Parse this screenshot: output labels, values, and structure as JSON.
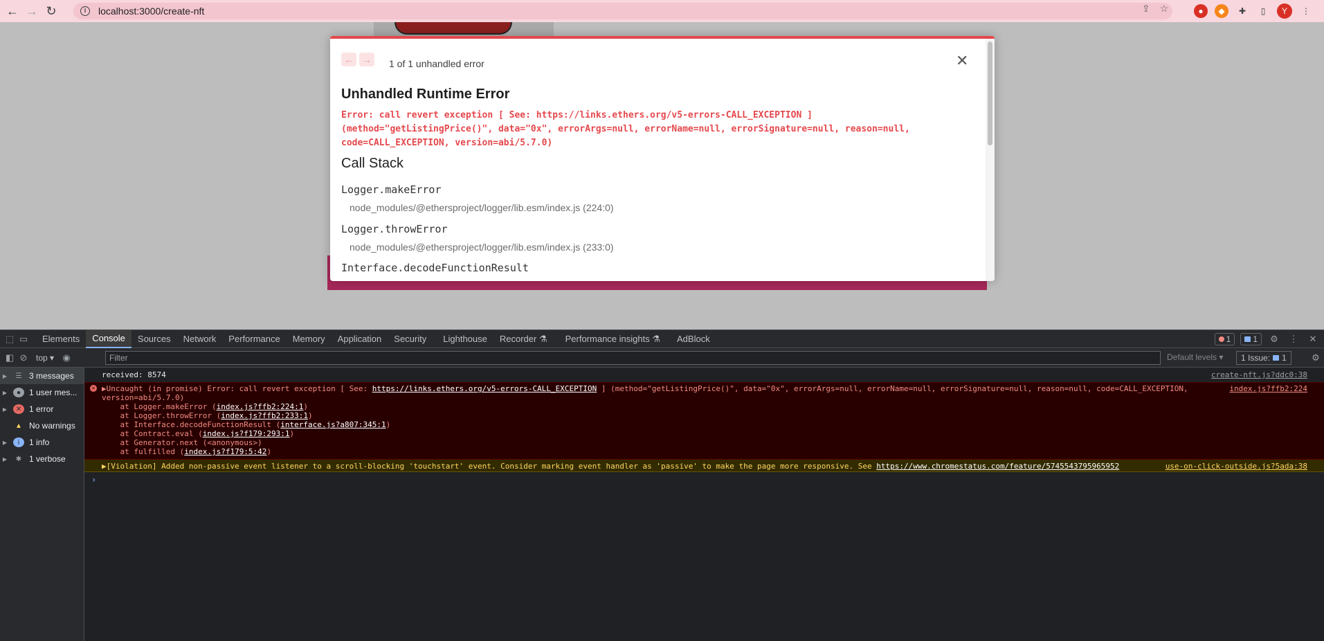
{
  "browser": {
    "url": "localhost:3000/create-nft",
    "avatar_letter": "Y"
  },
  "overlay": {
    "nav_prev": "←",
    "nav_next": "→",
    "error_count": "1 of 1 unhandled error",
    "close": "✕",
    "title": "Unhandled Runtime Error",
    "message": "Error: call revert exception [ See: https://links.ethers.org/v5-errors-CALL_EXCEPTION ]\n(method=\"getListingPrice()\", data=\"0x\", errorArgs=null, errorName=null, errorSignature=null, reason=null,\ncode=CALL_EXCEPTION, version=abi/5.7.0)",
    "call_stack_heading": "Call Stack",
    "frames": [
      {
        "fn": "Logger.makeError",
        "loc": "node_modules/@ethersproject/logger/lib.esm/index.js (224:0)"
      },
      {
        "fn": "Logger.throwError",
        "loc": "node_modules/@ethersproject/logger/lib.esm/index.js (233:0)"
      },
      {
        "fn": "Interface.decodeFunctionResult",
        "loc": ""
      }
    ]
  },
  "devtools": {
    "tabs": [
      "Elements",
      "Console",
      "Sources",
      "Network",
      "Performance",
      "Memory",
      "Application",
      "Security",
      "Lighthouse",
      "Recorder ⚗",
      "Performance insights ⚗",
      "AdBlock"
    ],
    "active_tab": "Console",
    "error_badge": "1",
    "message_badge": "1",
    "context": "top ▾",
    "filter_placeholder": "Filter",
    "levels": "Default levels ▾",
    "issues": "1 Issue:",
    "issues_count": "1",
    "sidebar": [
      {
        "label": "3 messages",
        "icon": "list-icon"
      },
      {
        "label": "1 user mes...",
        "icon": "user-icon"
      },
      {
        "label": "1 error",
        "icon": "error-icon"
      },
      {
        "label": "No warnings",
        "icon": "warning-icon"
      },
      {
        "label": "1 info",
        "icon": "info-icon"
      },
      {
        "label": "1 verbose",
        "icon": "bug-icon"
      }
    ],
    "console": {
      "log1_text": "received: 8574",
      "log1_src": "create-nft.js?ddc0:38",
      "err_prefix": "▶Uncaught (in promise) Error: call revert exception [ See: ",
      "err_link": "https://links.ethers.org/v5-errors-CALL_EXCEPTION",
      "err_rest": " ] (method=\"getListingPrice()\", data=\"0x\", errorArgs=null, errorName=null, errorSignature=null, reason=null, code=CALL_EXCEPTION,",
      "err_line2": "version=abi/5.7.0)",
      "err_src": "index.js?ffb2:224",
      "stack": [
        {
          "pre": "    at Logger.makeError (",
          "link": "index.js?ffb2:224:1",
          "post": ")"
        },
        {
          "pre": "    at Logger.throwError (",
          "link": "index.js?ffb2:233:1",
          "post": ")"
        },
        {
          "pre": "    at Interface.decodeFunctionResult (",
          "link": "interface.js?a807:345:1",
          "post": ")"
        },
        {
          "pre": "    at Contract.eval (",
          "link": "index.js?f179:293:1",
          "post": ")"
        },
        {
          "pre": "    at Generator.next (<anonymous>)",
          "link": "",
          "post": ""
        },
        {
          "pre": "    at fulfilled (",
          "link": "index.js?f179:5:42",
          "post": ")"
        }
      ],
      "warn_text": "▶[Violation] Added non-passive event listener to a scroll-blocking 'touchstart' event. Consider marking event handler as 'passive' to make the page more responsive. See ",
      "warn_link": "https://www.chromestatus.com/feature/5745543795965952",
      "warn_src": "use-on-click-outside.js?5ada:38",
      "prompt": "›"
    }
  }
}
